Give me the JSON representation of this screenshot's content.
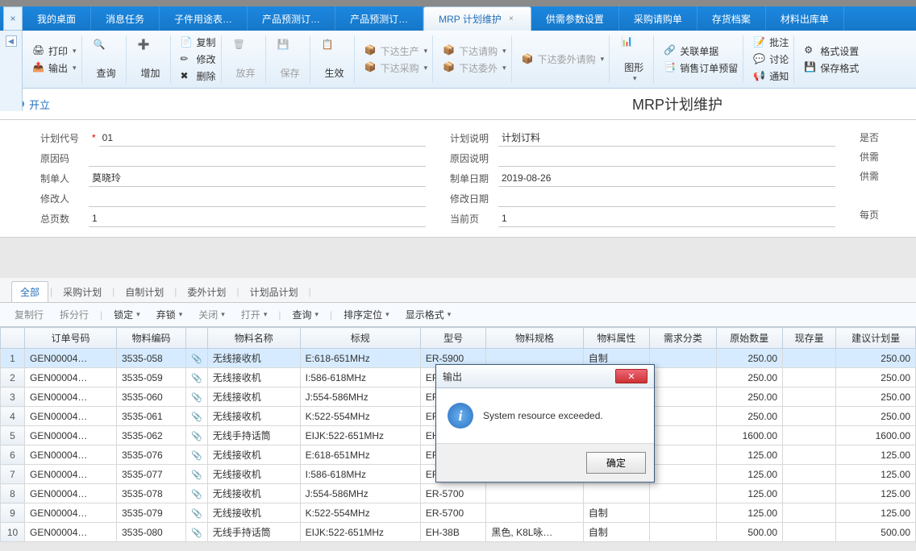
{
  "tabs": {
    "close_x": "×",
    "items": [
      {
        "label": "我的桌面"
      },
      {
        "label": "消息任务"
      },
      {
        "label": "子件用途表…"
      },
      {
        "label": "产品预测订…"
      },
      {
        "label": "产品预测订…"
      },
      {
        "label": "MRP 计划维护",
        "active": true,
        "closable": true
      },
      {
        "label": "供需参数设置"
      },
      {
        "label": "采购请购单"
      },
      {
        "label": "存货档案"
      },
      {
        "label": "材料出库单"
      }
    ]
  },
  "ribbon": {
    "print": "打印",
    "output": "输出",
    "query": "查询",
    "add": "增加",
    "copy": "复制",
    "modify": "修改",
    "delete": "删除",
    "abandon": "放弃",
    "save": "保存",
    "effect": "生效",
    "issue_prod": "下达生产",
    "issue_purch": "下达采购",
    "issue_req": "下达请购",
    "issue_out": "下达委外",
    "issue_outreq": "下达委外请购",
    "graph": "图形",
    "related": "关联单据",
    "sales_reserve": "销售订单预留",
    "approve": "批注",
    "discuss": "讨论",
    "notify": "通知",
    "format": "格式设置",
    "save_format": "保存格式"
  },
  "status": {
    "state": "开立",
    "title": "MRP计划维护"
  },
  "form": {
    "plan_code_label": "计划代号",
    "plan_code": "01",
    "reason_code_label": "原因码",
    "reason_code": "",
    "maker_label": "制单人",
    "maker": "莫晓玲",
    "modifier_label": "修改人",
    "modifier": "",
    "total_pages_label": "总页数",
    "total_pages": "1",
    "plan_desc_label": "计划说明",
    "plan_desc": "计划订料",
    "reason_desc_label": "原因说明",
    "reason_desc": "",
    "make_date_label": "制单日期",
    "make_date": "2019-08-26",
    "modify_date_label": "修改日期",
    "modify_date": "",
    "cur_page_label": "当前页",
    "cur_page": "1",
    "side1": "是否",
    "side2": "供需",
    "side3": "供需",
    "side4": "每页"
  },
  "subtabs": {
    "all": "全部",
    "purchase": "采购计划",
    "selfmake": "自制计划",
    "outsource": "委外计划",
    "planitem": "计划品计划"
  },
  "toolbar": {
    "copyrow": "复制行",
    "splitrow": "拆分行",
    "lock": "锁定",
    "unlock": "弃锁",
    "close": "关闭",
    "open": "打开",
    "query": "查询",
    "sort": "排序定位",
    "display": "显示格式"
  },
  "grid": {
    "headers": {
      "ordno": "订单号码",
      "matcode": "物料编码",
      "matname": "物料名称",
      "spec": "标规",
      "model": "型号",
      "matspec": "物料规格",
      "matprop": "物料属性",
      "demand": "需求分类",
      "origqty": "原始数量",
      "curqty": "现存量",
      "planqty": "建议计划量"
    },
    "rows": [
      {
        "n": "1",
        "ordno": "GEN00004…",
        "matcode": "3535-058",
        "matname": "无线接收机",
        "spec": "E:618-651MHz",
        "model": "ER-5900",
        "matspec": "",
        "matprop": "自制",
        "demand": "",
        "origqty": "250.00",
        "curqty": "",
        "planqty": "250.00"
      },
      {
        "n": "2",
        "ordno": "GEN00004…",
        "matcode": "3535-059",
        "matname": "无线接收机",
        "spec": "I:586-618MHz",
        "model": "ER-5900",
        "matspec": "",
        "matprop": "",
        "demand": "",
        "origqty": "250.00",
        "curqty": "",
        "planqty": "250.00"
      },
      {
        "n": "3",
        "ordno": "GEN00004…",
        "matcode": "3535-060",
        "matname": "无线接收机",
        "spec": "J:554-586MHz",
        "model": "ER-5900",
        "matspec": "",
        "matprop": "",
        "demand": "",
        "origqty": "250.00",
        "curqty": "",
        "planqty": "250.00"
      },
      {
        "n": "4",
        "ordno": "GEN00004…",
        "matcode": "3535-061",
        "matname": "无线接收机",
        "spec": "K:522-554MHz",
        "model": "ER-5900",
        "matspec": "",
        "matprop": "",
        "demand": "",
        "origqty": "250.00",
        "curqty": "",
        "planqty": "250.00"
      },
      {
        "n": "5",
        "ordno": "GEN00004…",
        "matcode": "3535-062",
        "matname": "无线手持话筒",
        "spec": "EIJK:522-651MHz",
        "model": "EH-59B",
        "matspec": "",
        "matprop": "",
        "demand": "",
        "origqty": "1600.00",
        "curqty": "",
        "planqty": "1600.00"
      },
      {
        "n": "6",
        "ordno": "GEN00004…",
        "matcode": "3535-076",
        "matname": "无线接收机",
        "spec": "E:618-651MHz",
        "model": "ER-5700",
        "matspec": "",
        "matprop": "",
        "demand": "",
        "origqty": "125.00",
        "curqty": "",
        "planqty": "125.00"
      },
      {
        "n": "7",
        "ordno": "GEN00004…",
        "matcode": "3535-077",
        "matname": "无线接收机",
        "spec": "I:586-618MHz",
        "model": "ER-5700",
        "matspec": "",
        "matprop": "",
        "demand": "",
        "origqty": "125.00",
        "curqty": "",
        "planqty": "125.00"
      },
      {
        "n": "8",
        "ordno": "GEN00004…",
        "matcode": "3535-078",
        "matname": "无线接收机",
        "spec": "J:554-586MHz",
        "model": "ER-5700",
        "matspec": "",
        "matprop": "",
        "demand": "",
        "origqty": "125.00",
        "curqty": "",
        "planqty": "125.00"
      },
      {
        "n": "9",
        "ordno": "GEN00004…",
        "matcode": "3535-079",
        "matname": "无线接收机",
        "spec": "K:522-554MHz",
        "model": "ER-5700",
        "matspec": "",
        "matprop": "自制",
        "demand": "",
        "origqty": "125.00",
        "curqty": "",
        "planqty": "125.00"
      },
      {
        "n": "10",
        "ordno": "GEN00004…",
        "matcode": "3535-080",
        "matname": "无线手持话筒",
        "spec": "EIJK:522-651MHz",
        "model": "EH-38B",
        "matspec": "黑色, K8L咏…",
        "matprop": "自制",
        "demand": "",
        "origqty": "500.00",
        "curqty": "",
        "planqty": "500.00"
      }
    ]
  },
  "dialog": {
    "title": "输出",
    "message": "System resource exceeded.",
    "ok": "确定",
    "close_x": "✕"
  }
}
